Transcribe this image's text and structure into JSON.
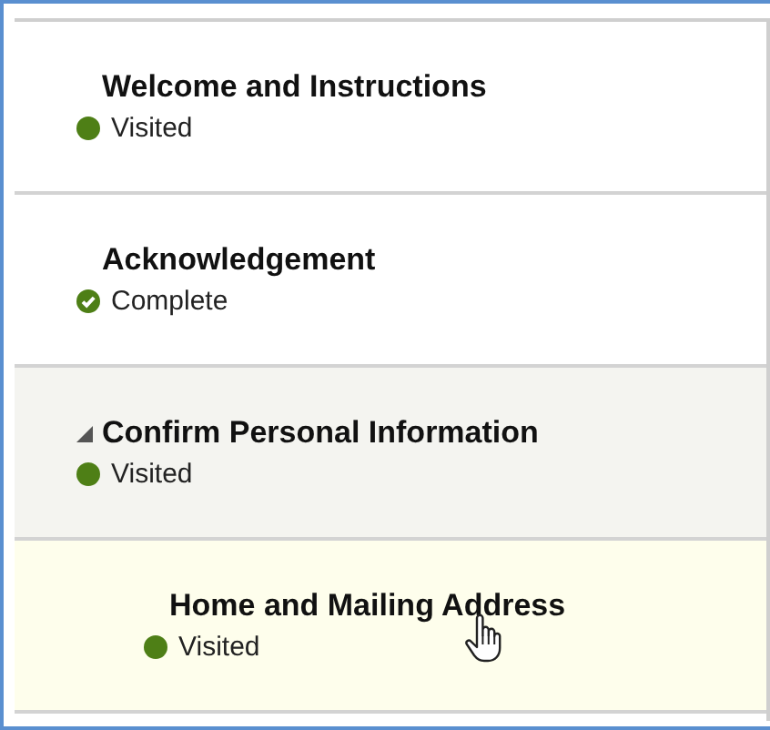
{
  "steps": [
    {
      "title": "Welcome and Instructions",
      "status": {
        "kind": "visited",
        "label": "Visited"
      },
      "selected": false
    },
    {
      "title": "Acknowledgement",
      "status": {
        "kind": "complete",
        "label": "Complete"
      },
      "selected": false
    },
    {
      "title": "Confirm Personal Information",
      "status": {
        "kind": "visited",
        "label": "Visited"
      },
      "selected": false,
      "expanded": true,
      "children": [
        {
          "title": "Home and Mailing Address",
          "status": {
            "kind": "visited",
            "label": "Visited"
          },
          "selected": true
        }
      ]
    }
  ]
}
